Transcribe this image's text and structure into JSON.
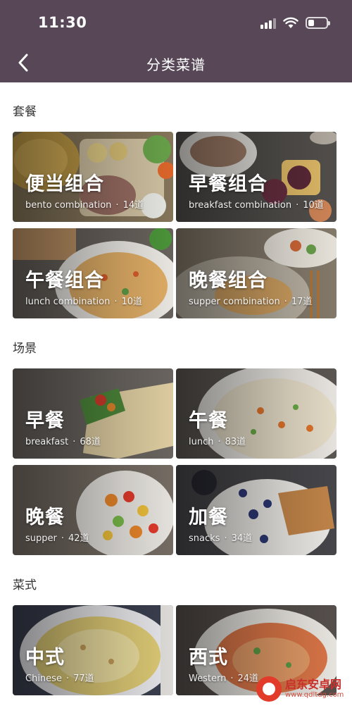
{
  "status_bar": {
    "time": "11:30"
  },
  "nav": {
    "title": "分类菜谱"
  },
  "sections": [
    {
      "label": "套餐",
      "cards": [
        {
          "title": "便当组合",
          "subtitle": "bento combination",
          "count": "14道"
        },
        {
          "title": "早餐组合",
          "subtitle": "breakfast combination",
          "count": "10道"
        },
        {
          "title": "午餐组合",
          "subtitle": "lunch combination",
          "count": "10道"
        },
        {
          "title": "晚餐组合",
          "subtitle": "supper combination",
          "count": "17道"
        }
      ]
    },
    {
      "label": "场景",
      "cards": [
        {
          "title": "早餐",
          "subtitle": "breakfast",
          "count": "68道"
        },
        {
          "title": "午餐",
          "subtitle": "lunch",
          "count": "83道"
        },
        {
          "title": "晚餐",
          "subtitle": "supper",
          "count": "42道"
        },
        {
          "title": "加餐",
          "subtitle": "snacks",
          "count": "34道"
        }
      ]
    },
    {
      "label": "菜式",
      "cards": [
        {
          "title": "中式",
          "subtitle": "Chinese",
          "count": "77道"
        },
        {
          "title": "西式",
          "subtitle": "Western",
          "count": "24道"
        }
      ]
    }
  ],
  "separator": "·",
  "watermark": {
    "name": "启东安卓网",
    "url": "www.qdltdg.com"
  },
  "colors": {
    "header": "#574757",
    "card_text": "#ffffff",
    "section_text": "#333333"
  },
  "icons": {
    "back": "chevron-left-icon",
    "signal": "signal-icon",
    "wifi": "wifi-icon",
    "battery": "battery-icon"
  }
}
